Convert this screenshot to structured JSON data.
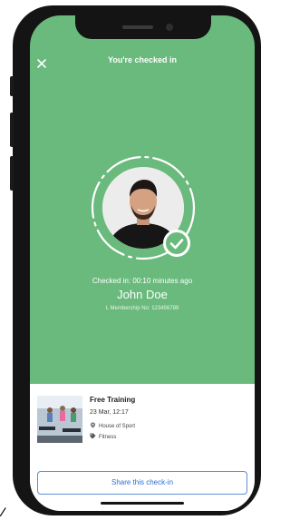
{
  "header": {
    "title": "You're checked in"
  },
  "profile": {
    "checkin_text": "Checked in: 00:10 minutes ago",
    "name": "John Doe",
    "membership": "L Membership No: 123456789"
  },
  "class_card": {
    "title": "Free Training",
    "date": "23 Mar, 12:17",
    "location": "House of Sport",
    "category": "Fitness"
  },
  "share_button": {
    "label": "Share this check-in"
  },
  "colors": {
    "accent_green": "#6aba7d",
    "share_blue": "#2d6ed1"
  },
  "icons": [
    "close-icon",
    "check-icon",
    "location-pin-icon",
    "tag-icon"
  ]
}
